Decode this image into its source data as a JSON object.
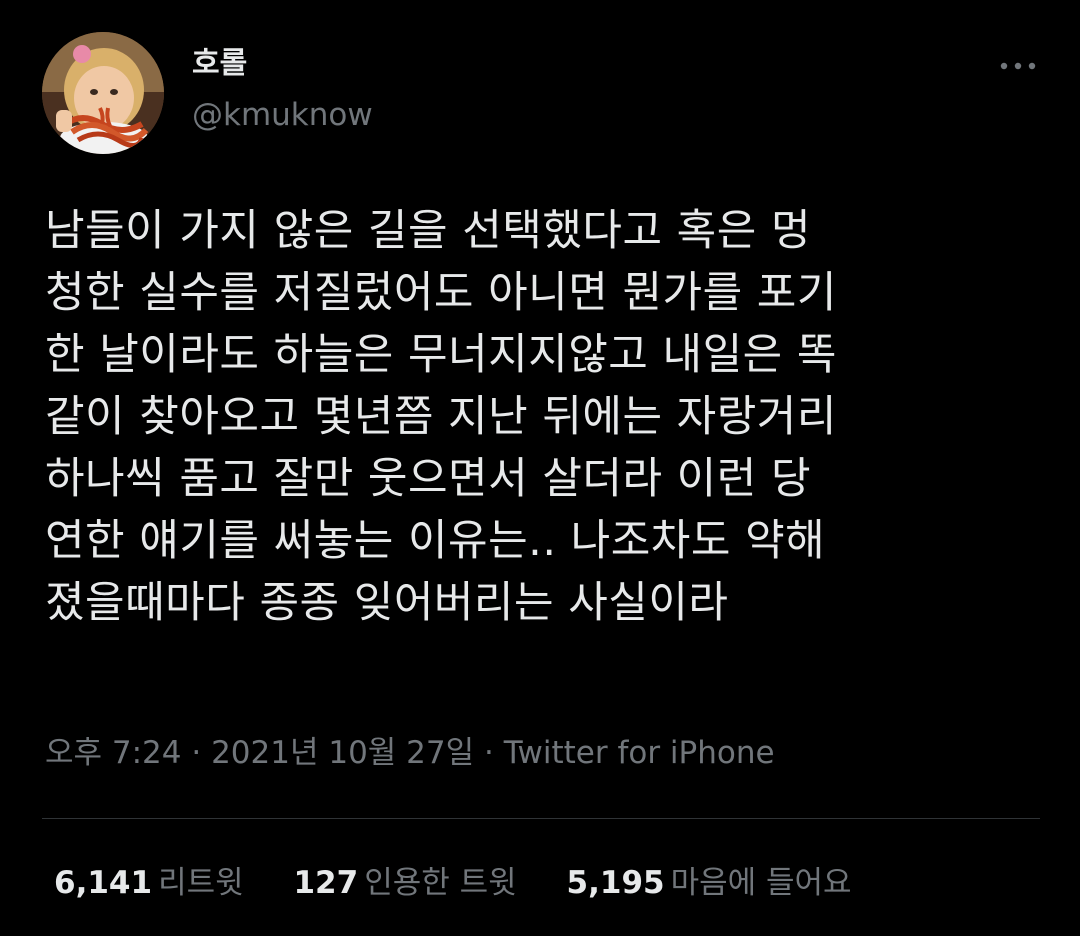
{
  "author": {
    "display_name": "호롤",
    "handle": "@kmuknow",
    "avatar_icon": "child-eating-spaghetti-avatar"
  },
  "menu": {
    "more_icon": "more-horizontal-icon"
  },
  "tweet": {
    "text_lines": [
      "남들이 가지 않은 길을 선택했다고 혹은 멍",
      "청한 실수를 저질렀어도 아니면 뭔가를 포기",
      "한 날이라도 하늘은 무너지지않고 내일은 똑",
      "같이 찾아오고 몇년쯤 지난 뒤에는 자랑거리",
      "하나씩 품고 잘만 웃으면서 살더라 이런 당",
      "연한 얘기를 써놓는 이유는.. 나조차도 약해",
      "졌을때마다 종종 잊어버리는 사실이라"
    ],
    "time": "오후 7:24",
    "separator": " · ",
    "date": "2021년 10월 27일",
    "source": "Twitter for iPhone"
  },
  "stats": [
    {
      "count": "6,141",
      "label": "리트윗"
    },
    {
      "count": "127",
      "label": "인용한 트윗"
    },
    {
      "count": "5,195",
      "label": "마음에 들어요"
    }
  ],
  "colors": {
    "background": "#000000",
    "primary_text": "#e7e9ea",
    "secondary_text": "#71767b",
    "divider": "#2f3336"
  }
}
